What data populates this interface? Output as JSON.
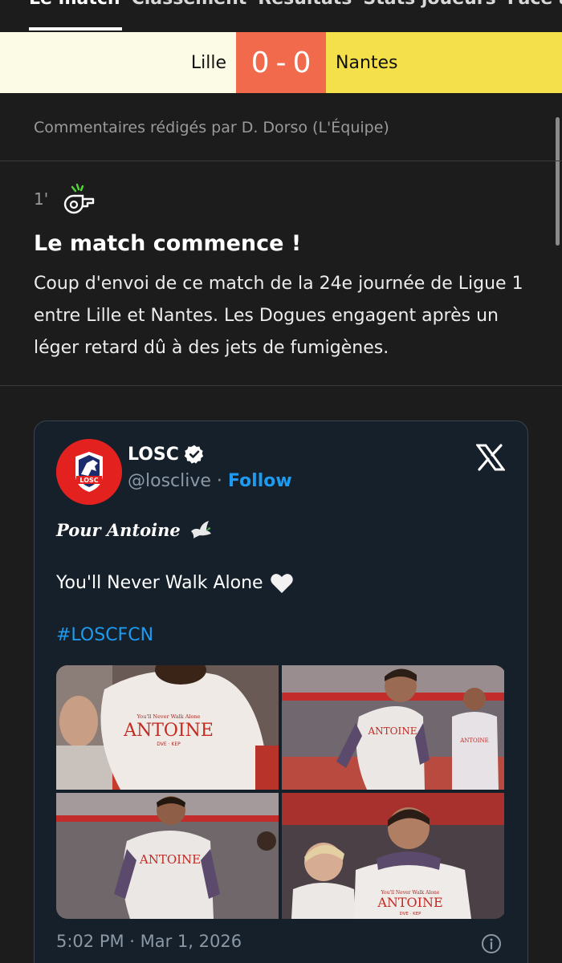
{
  "top_tabs": [
    "Le match",
    "Classement",
    "Résultats",
    "Stats joueurs",
    "Face à face"
  ],
  "score": {
    "home": "Lille",
    "home_goals": "0",
    "separator": "-",
    "away_goals": "0",
    "away": "Nantes"
  },
  "colors": {
    "home": "#fcfbe6",
    "score": "#f06a4b",
    "away": "#f4e04b",
    "accent": "#1d9bf0"
  },
  "commentary": {
    "author": "Commentaires rédigés par D. Dorso (L'Équipe)"
  },
  "event": {
    "minute": "1'",
    "icon": "whistle-icon",
    "title": "Le match commence !",
    "text": "Coup d'envoi de ce match de la 24e journée de Ligue 1 entre Lille et Nantes. Les Dogues engagent après un léger retard dû à des jets de fumigènes."
  },
  "tweet": {
    "name": "LOSC",
    "handle": "@losclive",
    "dot": "·",
    "follow": "Follow",
    "line1": "Pour Antoine",
    "line2": "You'll Never Walk Alone",
    "hashtag": "#LOSCFCN",
    "timestamp": "5:02 PM · Mar 1, 2026",
    "avatar_text": "LOSC",
    "shirt_text": "ANTOINE",
    "shirt_top": "You'll Never Walk Alone",
    "shirt_sub": "DVE · KEP"
  }
}
